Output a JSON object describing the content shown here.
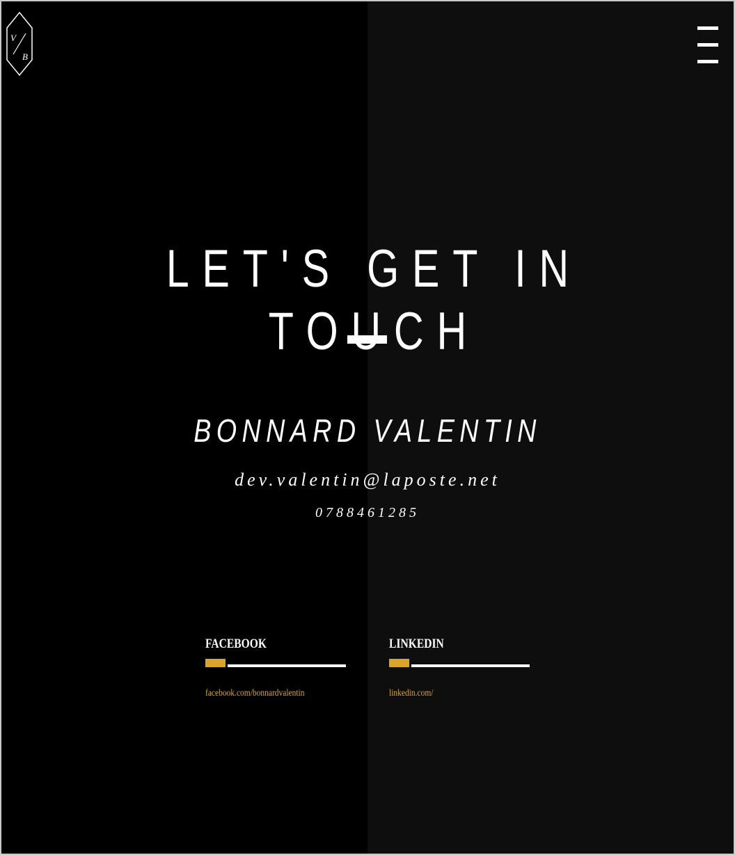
{
  "logo": {
    "letters": [
      "V",
      "B"
    ],
    "icon": "hexagon-monogram-logo"
  },
  "menu": {
    "icon": "hamburger-menu-icon"
  },
  "hero": {
    "headline": "LET'S GET IN TOUCH"
  },
  "contact": {
    "name": "BONNARD VALENTIN",
    "email": "dev.valentin@laposte.net",
    "phone": "0788461285"
  },
  "social": [
    {
      "title": "FACEBOOK",
      "link": "facebook.com/bonnardvalentin"
    },
    {
      "title": "LINKEDIN",
      "link": "linkedin.com/"
    }
  ],
  "colors": {
    "background_left": "#000000",
    "background_right": "#0e0e0e",
    "text": "#ffffff",
    "accent": "#d9a52a"
  }
}
